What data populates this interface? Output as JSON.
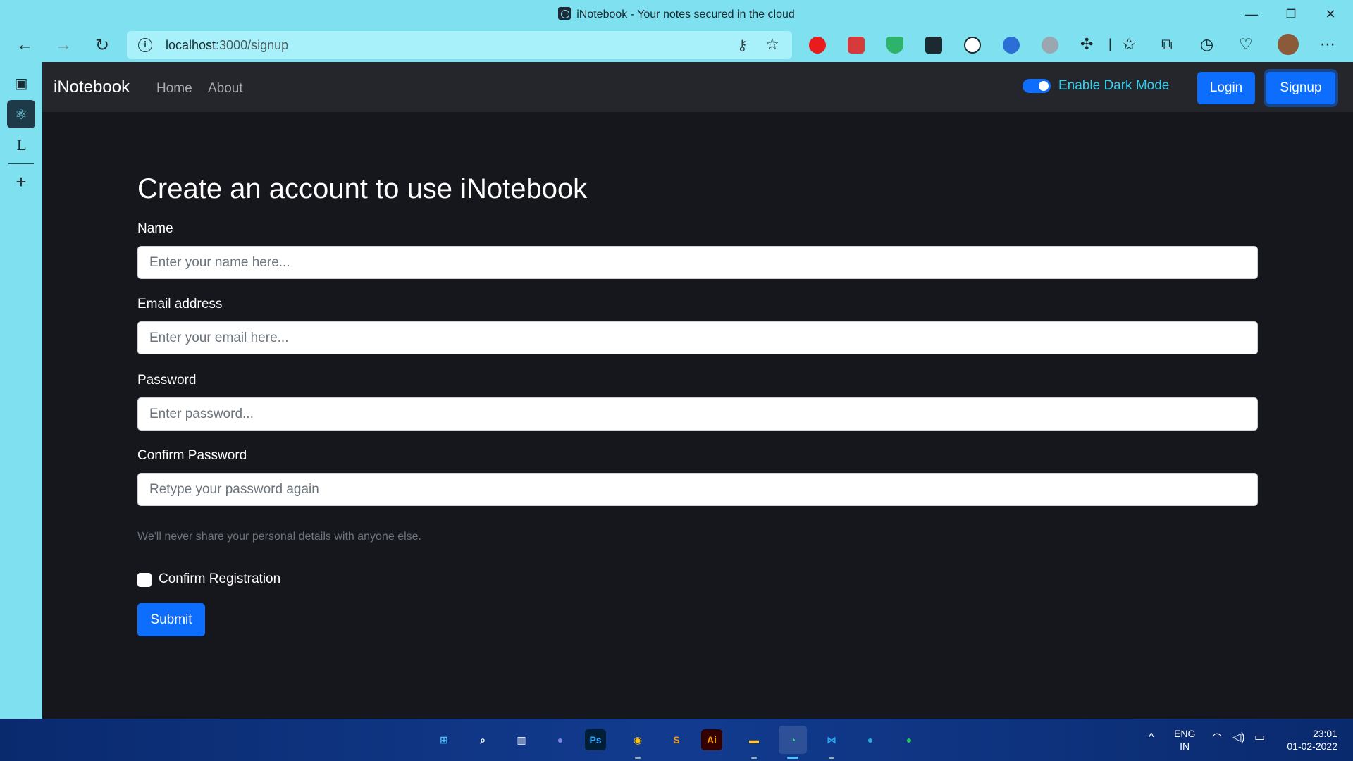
{
  "window": {
    "title": "iNotebook - Your notes secured in the cloud",
    "controls": [
      "—",
      "❐",
      "✕"
    ]
  },
  "toolbar": {
    "url_host": "localhost",
    "url_path": ":3000/signup",
    "icons": [
      "back-icon",
      "forward-icon",
      "refresh-icon",
      "info-icon",
      "key-icon",
      "favorite-add-icon",
      "extensions-icon",
      "favorites-icon",
      "collections-icon",
      "history-icon",
      "performance-icon",
      "profile-avatar",
      "more-icon"
    ]
  },
  "sidebar": {
    "items": [
      "tabs-icon",
      "react-icon",
      "l-icon",
      "plus-icon"
    ]
  },
  "navbar": {
    "brand": "iNotebook",
    "links": [
      "Home",
      "About"
    ],
    "dark_mode_label": "Enable Dark Mode",
    "dark_mode_on": true,
    "login": "Login",
    "signup": "Signup"
  },
  "form": {
    "heading": "Create an account to use iNotebook",
    "name_label": "Name",
    "name_placeholder": "Enter your name here...",
    "email_label": "Email address",
    "email_placeholder": "Enter your email here...",
    "password_label": "Password",
    "password_placeholder": "Enter password...",
    "confirm_label": "Confirm Password",
    "confirm_placeholder": "Retype your password again",
    "help_text": "We'll never share your personal details with anyone else.",
    "checkbox_label": "Confirm Registration",
    "submit": "Submit"
  },
  "taskbar": {
    "apps": [
      {
        "name": "start-icon",
        "glyph": "⊞",
        "color": "#4cc2ff"
      },
      {
        "name": "search-icon",
        "glyph": "⌕",
        "color": "#ffffff"
      },
      {
        "name": "widgets-icon",
        "glyph": "▥",
        "color": "#ffffff"
      },
      {
        "name": "teams-chat-icon",
        "glyph": "●",
        "color": "#7b83eb"
      },
      {
        "name": "photoshop-icon",
        "glyph": "Ps",
        "color": "#31a8ff"
      },
      {
        "name": "chrome-icon",
        "glyph": "◉",
        "color": "#fbbc05"
      },
      {
        "name": "sublime-text-icon",
        "glyph": "S",
        "color": "#ff9800"
      },
      {
        "name": "illustrator-icon",
        "glyph": "Ai",
        "color": "#ff9a00"
      },
      {
        "name": "file-explorer-icon",
        "glyph": "▬",
        "color": "#ffc83d"
      },
      {
        "name": "edge-icon",
        "glyph": "◔",
        "color": "#3ddc84"
      },
      {
        "name": "vscode-icon",
        "glyph": "⋈",
        "color": "#23a9f2"
      },
      {
        "name": "app-blue-icon",
        "glyph": "●",
        "color": "#2aa8e0"
      },
      {
        "name": "app-green-icon",
        "glyph": "●",
        "color": "#27c256"
      }
    ],
    "tray_caret": "^",
    "lang_top": "ENG",
    "lang_bottom": "IN",
    "time": "23:01",
    "date": "01-02-2022"
  }
}
